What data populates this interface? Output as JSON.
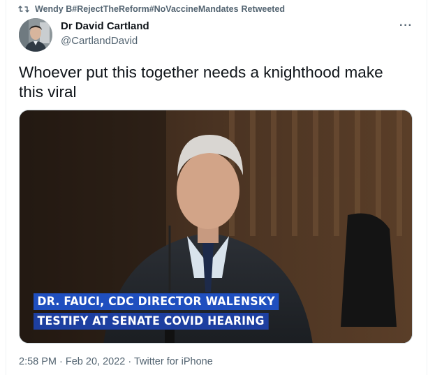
{
  "retweet": {
    "icon": "retweet-icon",
    "user": "Wendy B#RejectTheReform#NoVaccineMandates",
    "action": "Retweeted"
  },
  "author": {
    "name": "Dr David Cartland",
    "handle": "@CartlandDavid",
    "avatar_icon": "avatar"
  },
  "more_label": "···",
  "tweet": {
    "text": "Whoever put this together needs a knighthood make this viral"
  },
  "media": {
    "caption_line1": "DR. FAUCI, CDC DIRECTOR WALENSKY",
    "caption_line2": "TESTIFY AT SENATE COVID HEARING"
  },
  "meta": {
    "time": "2:58 PM",
    "sep": " · ",
    "date": "Feb 20, 2022",
    "source": "Twitter for iPhone"
  },
  "colors": {
    "text_primary": "#0f1419",
    "text_secondary": "#536471",
    "caption_blue": "#1f4fbf"
  }
}
